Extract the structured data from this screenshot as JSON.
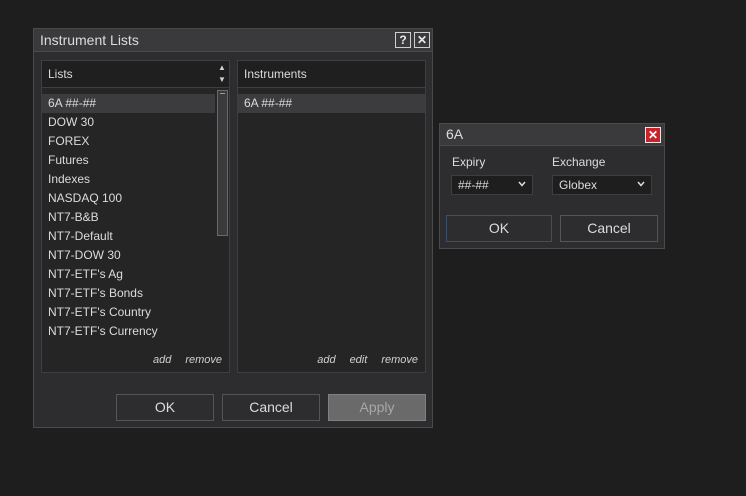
{
  "main_dialog": {
    "title": "Instrument Lists",
    "help_button": "?",
    "close_button": "✕",
    "lists_panel": {
      "header": "Lists",
      "items": [
        "6A ##-##",
        "DOW 30",
        "FOREX",
        "Futures",
        "Indexes",
        "NASDAQ 100",
        "NT7-B&B",
        "NT7-Default",
        "NT7-DOW 30",
        "NT7-ETF's Ag",
        "NT7-ETF's Bonds",
        "NT7-ETF's Country",
        "NT7-ETF's Currency"
      ],
      "selected_index": 0,
      "add_link": "add",
      "remove_link": "remove"
    },
    "instruments_panel": {
      "header": "Instruments",
      "items": [
        "6A ##-##"
      ],
      "selected_index": 0,
      "add_link": "add",
      "edit_link": "edit",
      "remove_link": "remove"
    },
    "ok_button": "OK",
    "cancel_button": "Cancel",
    "apply_button": "Apply"
  },
  "instrument_dialog": {
    "title": "6A",
    "close_button": "✕",
    "expiry_label": "Expiry",
    "expiry_value": "##-##",
    "exchange_label": "Exchange",
    "exchange_value": "Globex",
    "ok_button": "OK",
    "cancel_button": "Cancel"
  }
}
